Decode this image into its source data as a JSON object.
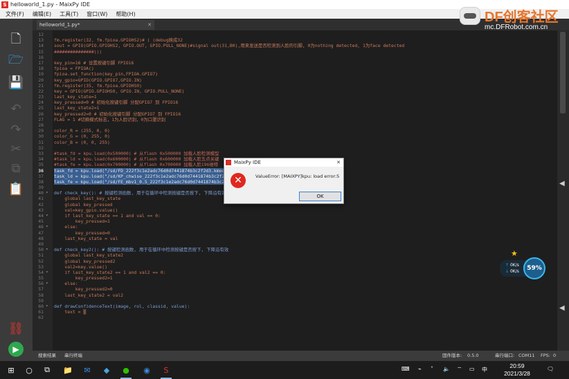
{
  "window": {
    "title": "helloworld_1.py - MaixPy IDE"
  },
  "menu": [
    "文件(F)",
    "编辑(E)",
    "工具(T)",
    "窗口(W)",
    "帮助(H)"
  ],
  "brand": {
    "logo_text": "DF创客社区",
    "url": "mc.DFRobot.com.cn"
  },
  "tab": {
    "label": "helloworld_1.py*"
  },
  "code_lines": [
    {
      "n": "12",
      "t": ""
    },
    {
      "n": "13",
      "t": "fm.register(32, fm.fpioa.GPIOHS2)# ( (debug换成32"
    },
    {
      "n": "14",
      "t": "sout = GPIO(GPIO.GPIOHS2, GPIO.OUT, GPIO.PULL_NONE)#signal out(31,B0),用来发送是否检测到人脸的引脚, 0为nothing detected, 1为face detected"
    },
    {
      "n": "15",
      "t": "###############)))"
    },
    {
      "n": "16",
      "t": ""
    },
    {
      "n": "17",
      "t": "key_pin=16 # 设置按键引脚 FPIO16"
    },
    {
      "n": "18",
      "t": "fpioa = FPIOA()"
    },
    {
      "n": "19",
      "t": "fpioa.set_function(key_pin,FPIOA.GPIO7)"
    },
    {
      "n": "20",
      "t": "key_gpio=GPIO(GPIO.GPIO7,GPIO.IN)"
    },
    {
      "n": "21",
      "t": "fm.register(35, fm.fpioa.GPIOHS0)"
    },
    {
      "n": "22",
      "t": "key = GPIO(GPIO.GPIOHS0, GPIO.IN, GPIO.PULL_NONE)"
    },
    {
      "n": "23",
      "t": "last_key_state=1"
    },
    {
      "n": "24",
      "t": "key_pressed=0 # 初始化按键引脚 分配GPIO7 到 FPIO16"
    },
    {
      "n": "25",
      "t": "last_key_state2=1"
    },
    {
      "n": "26",
      "t": "key_pressed2=0 # 初始化按键引脚 分配GPIO7 到 FPIO16"
    },
    {
      "n": "27",
      "t": "FLAG = 1 #切换模式标志，1为人脸识别，0为口罩识别"
    },
    {
      "n": "28",
      "t": ""
    },
    {
      "n": "29",
      "t": "color_R = (255, 0, 0)"
    },
    {
      "n": "30",
      "t": "color_G = (0, 255, 0)"
    },
    {
      "n": "31",
      "t": "color_B = (0, 0, 255)"
    },
    {
      "n": "32",
      "t": ""
    },
    {
      "n": "33",
      "t": "#task_fd = kpu.load(0x500000) # 从flash 0x500000 加载人脸检测模型"
    },
    {
      "n": "34",
      "t": "#task_ld = kpu.load(0x600000) # 从flash 0x600000 加载人脸五点关键"
    },
    {
      "n": "35",
      "t": "#task_fe = kpu.load(0x700000) # 从flash 0x700000 加载人脸196维特"
    },
    {
      "n": "36",
      "t": "task_fd = kpu.load(\"/sd/FD_222f3c1e2adc76d0d7441874b3c2f2d3.kmodel\")"
    },
    {
      "n": "37",
      "t": "task_ld = kpu.load(\"/sd/KP_chwise_222f3c1e2adc76d0d7441874b3c2f2d3.kmodel\")"
    },
    {
      "n": "38",
      "t": "task_fe = kpu.load(\"/sd/FE_mbv1_0.5_222f3c1e2adc76d0d7441874b3c2f2d3.kmodel\")"
    },
    {
      "n": "39",
      "t": ""
    },
    {
      "n": "40",
      "t": "def check_key(): # 按键检测函数, 用于在循环中检测按键是否按下, 下降沿有效"
    },
    {
      "n": "41",
      "t": "    global last_key_state"
    },
    {
      "n": "42",
      "t": "    global key_pressed"
    },
    {
      "n": "43",
      "t": "    val=key_gpio.value()"
    },
    {
      "n": "44",
      "t": "    if last_key_state == 1 and val == 0:"
    },
    {
      "n": "45",
      "t": "        key_pressed=1"
    },
    {
      "n": "46",
      "t": "    else:"
    },
    {
      "n": "47",
      "t": "        key_pressed=0"
    },
    {
      "n": "48",
      "t": "    last_key_state = val"
    },
    {
      "n": "49",
      "t": ""
    },
    {
      "n": "50",
      "t": "def check_key2(): # 按键检测函数, 用于在循环中检测按键是否按下, 下降沿有效"
    },
    {
      "n": "51",
      "t": "    global last_key_state2"
    },
    {
      "n": "52",
      "t": "    global key_pressed2"
    },
    {
      "n": "53",
      "t": "    val2=key.value()"
    },
    {
      "n": "54",
      "t": "    if last_key_state2 == 1 and val2 == 0:"
    },
    {
      "n": "55",
      "t": "        key_pressed2=1"
    },
    {
      "n": "56",
      "t": "    else:"
    },
    {
      "n": "57",
      "t": "        key_pressed2=0"
    },
    {
      "n": "58",
      "t": "    last_key_state2 = val2"
    },
    {
      "n": "59",
      "t": ""
    },
    {
      "n": "60",
      "t": "def drawConfidenceText(image, rol, classid, value):"
    },
    {
      "n": "61",
      "t": "    text = ▒"
    },
    {
      "n": "62",
      "t": ""
    }
  ],
  "dialog": {
    "title": "MaixPy IDE",
    "message": "ValueError: [MAIXPY]kpu: load error:5",
    "ok_label": "OK",
    "close_glyph": "✕",
    "icon": "error-x-icon"
  },
  "net_widget": {
    "up": "0K/s",
    "down": "0K/s",
    "percent": "59%"
  },
  "statusbar": {
    "search_results": "搜索结果",
    "serial_terminal": "串行终端",
    "firmware_label": "固件版本:",
    "firmware_value": "0.5.0",
    "port_label": "串行端口:",
    "port_value": "COM11",
    "fps_label": "FPS:",
    "fps_value": "0"
  },
  "taskbar": {
    "time": "20:59",
    "date": "2021/3/28",
    "ime": "中"
  },
  "colors": {
    "accent": "#d9302b",
    "selection": "#3a5f91",
    "run": "#2ea84f",
    "error": "#e0281f"
  }
}
